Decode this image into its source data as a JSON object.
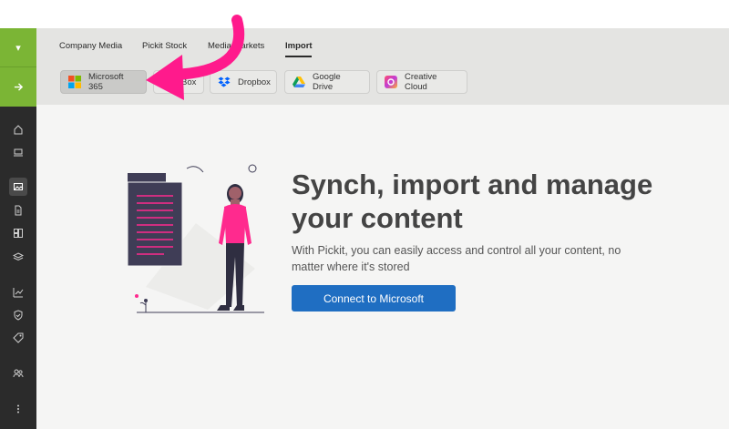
{
  "nav": {
    "tabs": [
      {
        "label": "Company Media"
      },
      {
        "label": "Pickit Stock"
      },
      {
        "label": "Media Markets"
      },
      {
        "label": "Import"
      }
    ],
    "active_tab": "Import"
  },
  "sources": [
    {
      "label": "Microsoft 365",
      "icon": "microsoft-logo-icon"
    },
    {
      "label": "Box",
      "icon": "box-logo-icon"
    },
    {
      "label": "Dropbox",
      "icon": "dropbox-logo-icon"
    },
    {
      "label": "Google Drive",
      "icon": "google-drive-logo-icon"
    },
    {
      "label": "Creative Cloud",
      "icon": "creative-cloud-logo-icon"
    }
  ],
  "main": {
    "headline": "Synch, import and manage your content",
    "subtext": "With Pickit, you can easily access and control all your content, no matter where it's stored",
    "cta_label": "Connect to Microsoft"
  },
  "colors": {
    "rail_green": "#7bb535",
    "rail_dark": "#2b2b2b",
    "accent_blue": "#1f6ec2",
    "arrow_pink": "#ff1a8c",
    "illustration_pink": "#ff2a8e"
  }
}
